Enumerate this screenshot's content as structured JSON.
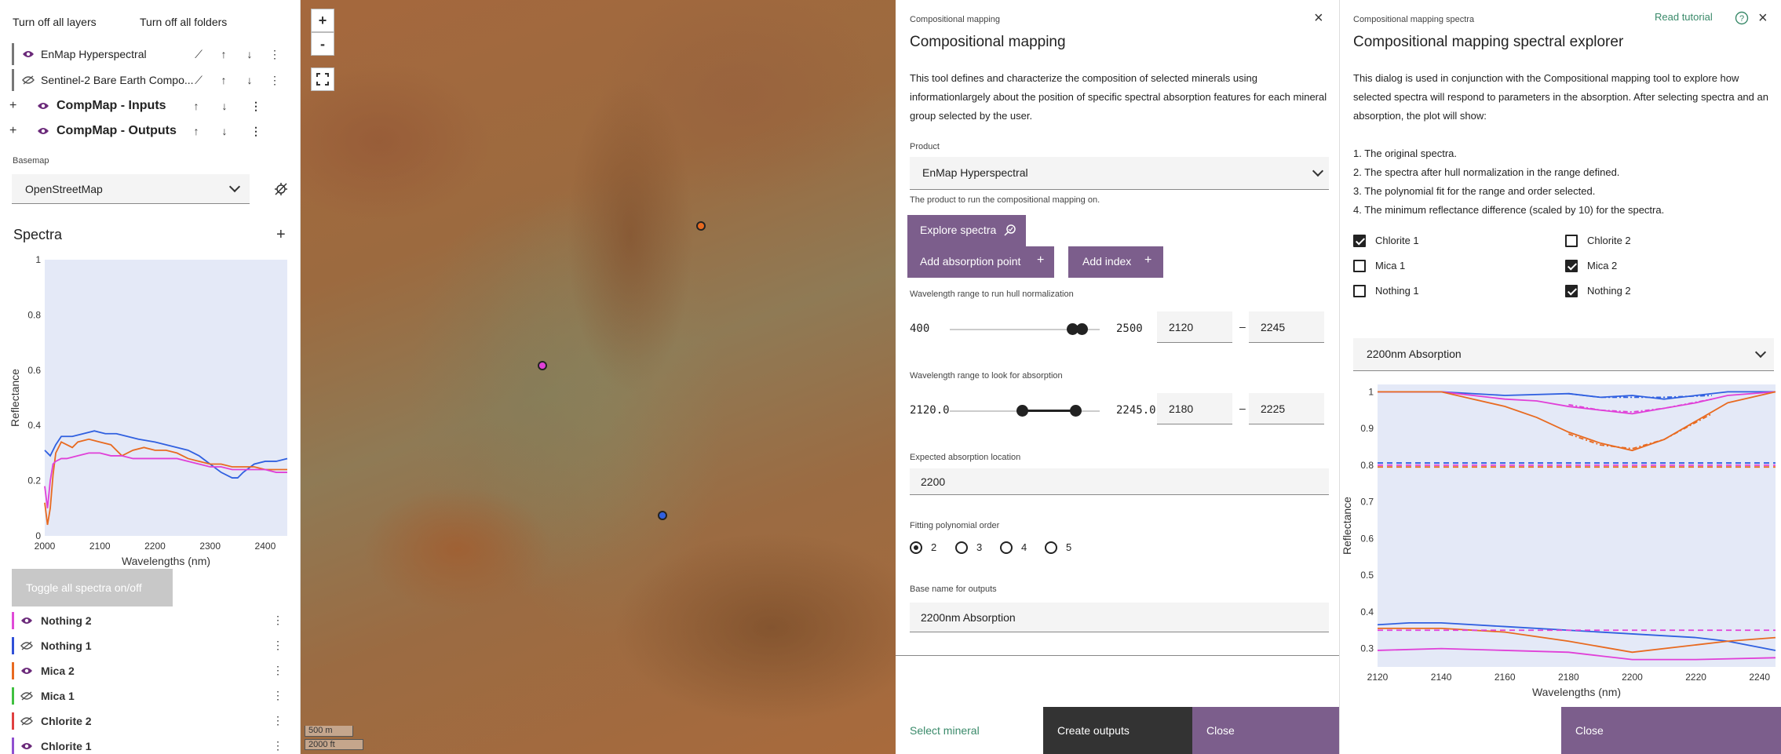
{
  "left": {
    "turn_off_layers": "Turn off all layers",
    "turn_off_folders": "Turn off all folders",
    "layers": [
      {
        "name": "EnMap Hyperspectral",
        "visible": true
      },
      {
        "name": "Sentinel-2 Bare Earth Compo...",
        "visible": false
      }
    ],
    "groups": [
      {
        "name": "CompMap - Inputs"
      },
      {
        "name": "CompMap - Outputs"
      }
    ],
    "basemap_label": "Basemap",
    "basemap_value": "OpenStreetMap",
    "spectra_title": "Spectra",
    "toggle_spectra": "Toggle all spectra on/off",
    "spectra": [
      {
        "name": "Nothing 2",
        "color": "#e04ad8",
        "visible": true
      },
      {
        "name": "Nothing 1",
        "color": "#3050d8",
        "visible": false
      },
      {
        "name": "Mica 2",
        "color": "#e86a20",
        "visible": true
      },
      {
        "name": "Mica 1",
        "color": "#40c040",
        "visible": false
      },
      {
        "name": "Chlorite 2",
        "color": "#e04040",
        "visible": false
      },
      {
        "name": "Chlorite 1",
        "color": "#9050d0",
        "visible": true
      }
    ]
  },
  "map": {
    "zoom_in": "+",
    "zoom_out": "-",
    "scale_m": "500 m",
    "scale_ft": "2000 ft"
  },
  "mid": {
    "breadcrumb": "Compositional mapping",
    "title": "Compositional mapping",
    "description": "This tool defines and characterize the composition of selected minerals using informationlargely about the position of specific spectral absorption features for each mineral group selected by the user.",
    "product_label": "Product",
    "product_value": "EnMap Hyperspectral",
    "product_help": "The product to run the compositional mapping on.",
    "explore_spectra": "Explore spectra",
    "add_absorption": "Add absorption point",
    "add_index": "Add index",
    "hull_label": "Wavelength range to run hull normalization",
    "hull_min_label": "400",
    "hull_max_label": "2500",
    "hull_lo": "2120",
    "hull_hi": "2245",
    "hull_range": {
      "min": 400,
      "max": 2500,
      "lo": 2120,
      "hi": 2245
    },
    "abs_label": "Wavelength range to look for absorption",
    "abs_min_label": "2120.0",
    "abs_max_label": "2245.0",
    "abs_lo": "2180",
    "abs_hi": "2225",
    "abs_range": {
      "min": 2120,
      "max": 2245,
      "lo": 2180,
      "hi": 2225
    },
    "dash": "–",
    "expected_label": "Expected absorption location",
    "expected_value": "2200",
    "poly_label": "Fitting polynomial order",
    "poly_options": [
      "2",
      "3",
      "4",
      "5"
    ],
    "poly_selected": "2",
    "basename_label": "Base name for outputs",
    "basename_value": "2200nm Absorption",
    "select_mineral": "Select mineral",
    "create_outputs": "Create outputs",
    "close": "Close"
  },
  "right": {
    "breadcrumb": "Compositional mapping spectra",
    "read_tutorial": "Read tutorial",
    "title": "Compositional mapping spectral explorer",
    "description": "This dialog is used in conjunction with the Compositional mapping tool to explore how selected spectra will respond to parameters in the absorption. After selecting spectra and an absorption, the plot will show:",
    "list": [
      "1. The original spectra.",
      "2. The spectra after hull normalization in the range defined.",
      "3. The polynomial fit for the range and order selected.",
      "4. The minimum reflectance difference (scaled by 10) for the spectra."
    ],
    "checkboxes": [
      {
        "label": "Chlorite 1",
        "checked": true
      },
      {
        "label": "Chlorite 2",
        "checked": false
      },
      {
        "label": "Mica 1",
        "checked": false
      },
      {
        "label": "Mica 2",
        "checked": true
      },
      {
        "label": "Nothing 1",
        "checked": false
      },
      {
        "label": "Nothing 2",
        "checked": true
      }
    ],
    "absorption_select": "2200nm Absorption",
    "close": "Close"
  },
  "chart_data": [
    {
      "type": "line",
      "xlabel": "Wavelengths (nm)",
      "ylabel": "Reflectance",
      "xlim": [
        2000,
        2440
      ],
      "ylim": [
        0,
        1
      ],
      "xticks": [
        "2000",
        "2100",
        "2200",
        "2300",
        "2400"
      ],
      "yticks": [
        "0",
        "0.2",
        "0.4",
        "0.6",
        "0.8",
        "1"
      ],
      "grid": false,
      "series": [
        {
          "color": "#3060e0",
          "x": [
            2000,
            2010,
            2020,
            2030,
            2050,
            2070,
            2090,
            2110,
            2130,
            2150,
            2170,
            2200,
            2220,
            2240,
            2260,
            2280,
            2300,
            2320,
            2340,
            2350,
            2360,
            2380,
            2400,
            2420,
            2440
          ],
          "y": [
            0.31,
            0.29,
            0.33,
            0.36,
            0.36,
            0.37,
            0.38,
            0.37,
            0.37,
            0.36,
            0.35,
            0.34,
            0.33,
            0.32,
            0.31,
            0.29,
            0.26,
            0.23,
            0.21,
            0.21,
            0.23,
            0.26,
            0.27,
            0.27,
            0.28
          ]
        },
        {
          "color": "#e86a20",
          "x": [
            2000,
            2005,
            2010,
            2015,
            2020,
            2030,
            2040,
            2050,
            2060,
            2080,
            2100,
            2120,
            2140,
            2160,
            2180,
            2200,
            2220,
            2240,
            2260,
            2280,
            2300,
            2320,
            2340,
            2360,
            2380,
            2400,
            2420,
            2440
          ],
          "y": [
            0.12,
            0.04,
            0.1,
            0.22,
            0.3,
            0.34,
            0.33,
            0.32,
            0.34,
            0.35,
            0.34,
            0.33,
            0.29,
            0.31,
            0.32,
            0.31,
            0.31,
            0.3,
            0.28,
            0.27,
            0.26,
            0.26,
            0.25,
            0.25,
            0.25,
            0.24,
            0.24,
            0.24
          ]
        },
        {
          "color": "#e040d8",
          "x": [
            2000,
            2005,
            2010,
            2015,
            2020,
            2030,
            2040,
            2060,
            2080,
            2100,
            2120,
            2140,
            2160,
            2180,
            2200,
            2220,
            2240,
            2260,
            2280,
            2300,
            2320,
            2340,
            2360,
            2380,
            2400,
            2420,
            2440
          ],
          "y": [
            0.18,
            0.1,
            0.2,
            0.26,
            0.27,
            0.28,
            0.28,
            0.29,
            0.3,
            0.3,
            0.29,
            0.29,
            0.28,
            0.28,
            0.28,
            0.28,
            0.28,
            0.27,
            0.26,
            0.25,
            0.25,
            0.24,
            0.24,
            0.24,
            0.24,
            0.23,
            0.23
          ]
        }
      ]
    },
    {
      "type": "line",
      "xlabel": "Wavelengths (nm)",
      "ylabel": "Reflectance",
      "xlim": [
        2120,
        2245
      ],
      "ylim": [
        0.25,
        1.02
      ],
      "xticks": [
        "2120",
        "2140",
        "2160",
        "2180",
        "2200",
        "2220",
        "2240"
      ],
      "yticks": [
        "0.3",
        "0.4",
        "0.5",
        "0.6",
        "0.7",
        "0.8",
        "0.9",
        "1"
      ],
      "grid": false,
      "series": [
        {
          "color": "#3060e0",
          "style": "solid",
          "x": [
            2120,
            2140,
            2160,
            2180,
            2190,
            2200,
            2210,
            2220,
            2230,
            2245
          ],
          "y": [
            1.0,
            1.0,
            0.99,
            0.995,
            0.985,
            0.99,
            0.98,
            0.99,
            1.0,
            1.0
          ]
        },
        {
          "color": "#3060e0",
          "style": "dashdot",
          "x": [
            2180,
            2190,
            2200,
            2210,
            2225
          ],
          "y": [
            0.995,
            0.985,
            0.985,
            0.985,
            0.99
          ]
        },
        {
          "color": "#e040d8",
          "style": "solid",
          "x": [
            2120,
            2140,
            2150,
            2160,
            2170,
            2180,
            2190,
            2200,
            2210,
            2220,
            2230,
            2245
          ],
          "y": [
            1.0,
            1.0,
            0.99,
            0.98,
            0.975,
            0.96,
            0.95,
            0.94,
            0.955,
            0.97,
            0.99,
            1.0
          ]
        },
        {
          "color": "#e040d8",
          "style": "dashdot",
          "x": [
            2180,
            2190,
            2200,
            2210,
            2225
          ],
          "y": [
            0.965,
            0.95,
            0.945,
            0.955,
            0.98
          ]
        },
        {
          "color": "#e86a20",
          "style": "solid",
          "x": [
            2120,
            2140,
            2150,
            2160,
            2170,
            2180,
            2190,
            2200,
            2210,
            2220,
            2230,
            2245
          ],
          "y": [
            1.0,
            1.0,
            0.98,
            0.96,
            0.93,
            0.89,
            0.86,
            0.84,
            0.87,
            0.92,
            0.97,
            1.0
          ]
        },
        {
          "color": "#e86a20",
          "style": "dashdot",
          "x": [
            2180,
            2190,
            2200,
            2210,
            2225
          ],
          "y": [
            0.885,
            0.855,
            0.845,
            0.87,
            0.94
          ]
        },
        {
          "color": "#3060e0",
          "style": "dashed",
          "x": [
            2120,
            2245
          ],
          "y": [
            0.806,
            0.806
          ]
        },
        {
          "color": "#e040d8",
          "style": "dashed",
          "x": [
            2120,
            2245
          ],
          "y": [
            0.8,
            0.8
          ]
        },
        {
          "color": "#e86a20",
          "style": "dashed",
          "x": [
            2120,
            2245
          ],
          "y": [
            0.795,
            0.795
          ]
        },
        {
          "color": "#3060e0",
          "style": "solid",
          "x": [
            2120,
            2130,
            2140,
            2160,
            2180,
            2200,
            2220,
            2230,
            2245
          ],
          "y": [
            0.365,
            0.37,
            0.37,
            0.36,
            0.35,
            0.34,
            0.33,
            0.32,
            0.295
          ]
        },
        {
          "color": "#e86a20",
          "style": "solid",
          "x": [
            2120,
            2140,
            2160,
            2180,
            2200,
            2220,
            2230,
            2245
          ],
          "y": [
            0.355,
            0.355,
            0.345,
            0.32,
            0.29,
            0.31,
            0.32,
            0.33
          ]
        },
        {
          "color": "#e040d8",
          "style": "solid",
          "x": [
            2120,
            2140,
            2160,
            2180,
            2190,
            2200,
            2220,
            2245
          ],
          "y": [
            0.295,
            0.3,
            0.295,
            0.29,
            0.28,
            0.27,
            0.27,
            0.275
          ]
        },
        {
          "color": "#e040d8",
          "style": "dashed",
          "x": [
            2120,
            2245
          ],
          "y": [
            0.35,
            0.35
          ]
        }
      ]
    }
  ]
}
